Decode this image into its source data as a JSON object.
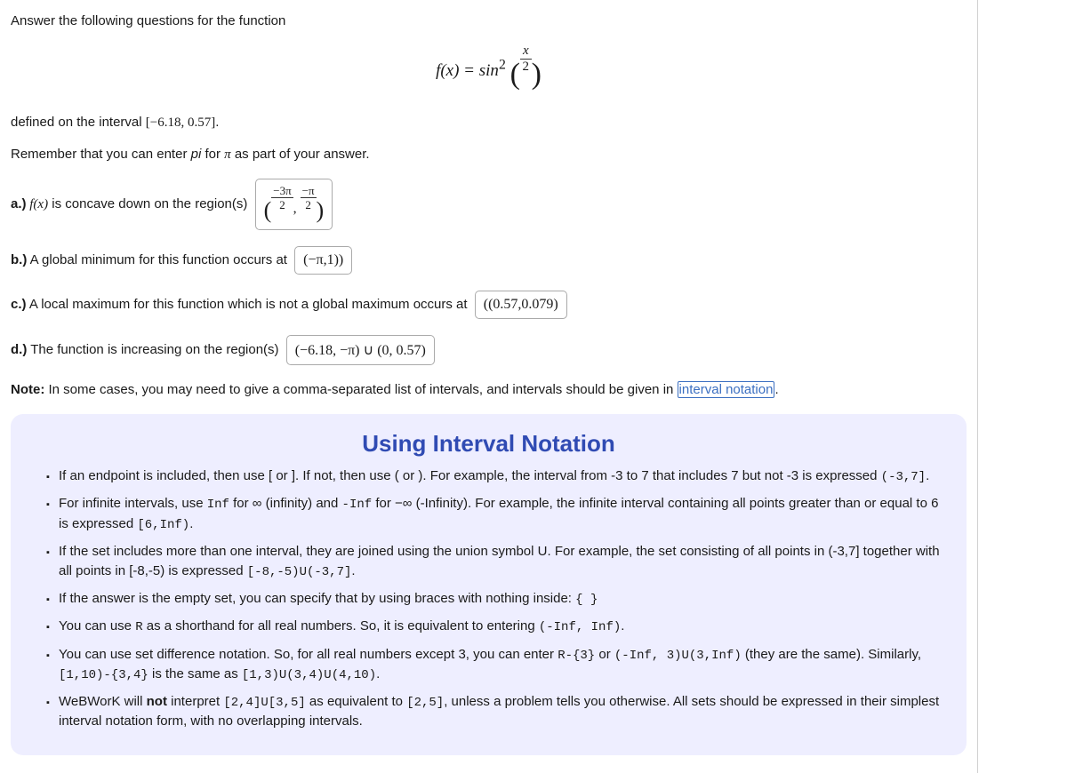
{
  "intro": "Answer the following questions for the function",
  "formula": {
    "lhs": "f(x) = sin",
    "sup": "2",
    "frac_num": "x",
    "frac_den": "2"
  },
  "defined": {
    "prefix": "defined on the interval ",
    "interval": "[−6.18, 0.57]",
    "suffix": "."
  },
  "remember": {
    "p1": "Remember that you can enter ",
    "pi_ital": "pi",
    "p2": " for ",
    "pi_sym": "π",
    "p3": " as part of your answer."
  },
  "qa": {
    "label": "a.)",
    "text1": " f(x)",
    "text2": " is concave down on the region(s)",
    "input_parts": {
      "num1": "−3π",
      "den1": "2",
      "sep": ", ",
      "num2": "−π",
      "den2": "2"
    }
  },
  "qb": {
    "label": "b.)",
    "text": " A global minimum for this function occurs at",
    "input": "(−π,1))"
  },
  "qc": {
    "label": "c.)",
    "text": " A local maximum for this function which is not a global maximum occurs at",
    "input": "((0.57,0.079)"
  },
  "qd": {
    "label": "d.)",
    "text": " The function is increasing on the region(s)",
    "input": "(−6.18, −π) ∪ (0, 0.57)"
  },
  "note": {
    "label": "Note:",
    "text1": " In some cases, you may need to give a comma-separated list of intervals, and intervals should be given in ",
    "link": "interval notation",
    "text2": "."
  },
  "panel": {
    "heading": "Using Interval Notation",
    "b1": {
      "t1": "If an endpoint is included, then use [ or ]. If not, then use ( or ). For example, the interval from -3 to 7 that includes 7 but not -3 is expressed ",
      "c1": "(-3,7]",
      "t2": "."
    },
    "b2": {
      "t1": "For infinite intervals, use ",
      "c1": "Inf",
      "t2": " for ∞ (infinity) and ",
      "c2": "-Inf",
      "t3": " for −∞ (-Infinity). For example, the infinite interval containing all points greater than or equal to 6 is expressed ",
      "c3": "[6,Inf)",
      "t4": "."
    },
    "b3": {
      "t1": "If the set includes more than one interval, they are joined using the union symbol U. For example, the set consisting of all points in (-3,7] together with all points in [-8,-5) is expressed ",
      "c1": "[-8,-5)U(-3,7]",
      "t2": "."
    },
    "b4": {
      "t1": "If the answer is the empty set, you can specify that by using braces with nothing inside: ",
      "c1": "{ }"
    },
    "b5": {
      "t1": "You can use ",
      "c1": "R",
      "t2": " as a shorthand for all real numbers. So, it is equivalent to entering ",
      "c2": "(-Inf, Inf)",
      "t3": "."
    },
    "b6": {
      "t1": "You can use set difference notation. So, for all real numbers except 3, you can enter ",
      "c1": "R-{3}",
      "t2": " or ",
      "c2": "(-Inf, 3)U(3,Inf)",
      "t3": " (they are the same). Similarly, ",
      "c3": "[1,10)-{3,4}",
      "t4": " is the same as ",
      "c4": "[1,3)U(3,4)U(4,10)",
      "t5": "."
    },
    "b7": {
      "t1": "WeBWorK will ",
      "bold": "not",
      "t2": " interpret ",
      "c1": "[2,4]U[3,5]",
      "t3": " as equivalent to ",
      "c2": "[2,5]",
      "t4": ", unless a problem tells you otherwise. All sets should be expressed in their simplest interval notation form, with no overlapping intervals."
    }
  }
}
